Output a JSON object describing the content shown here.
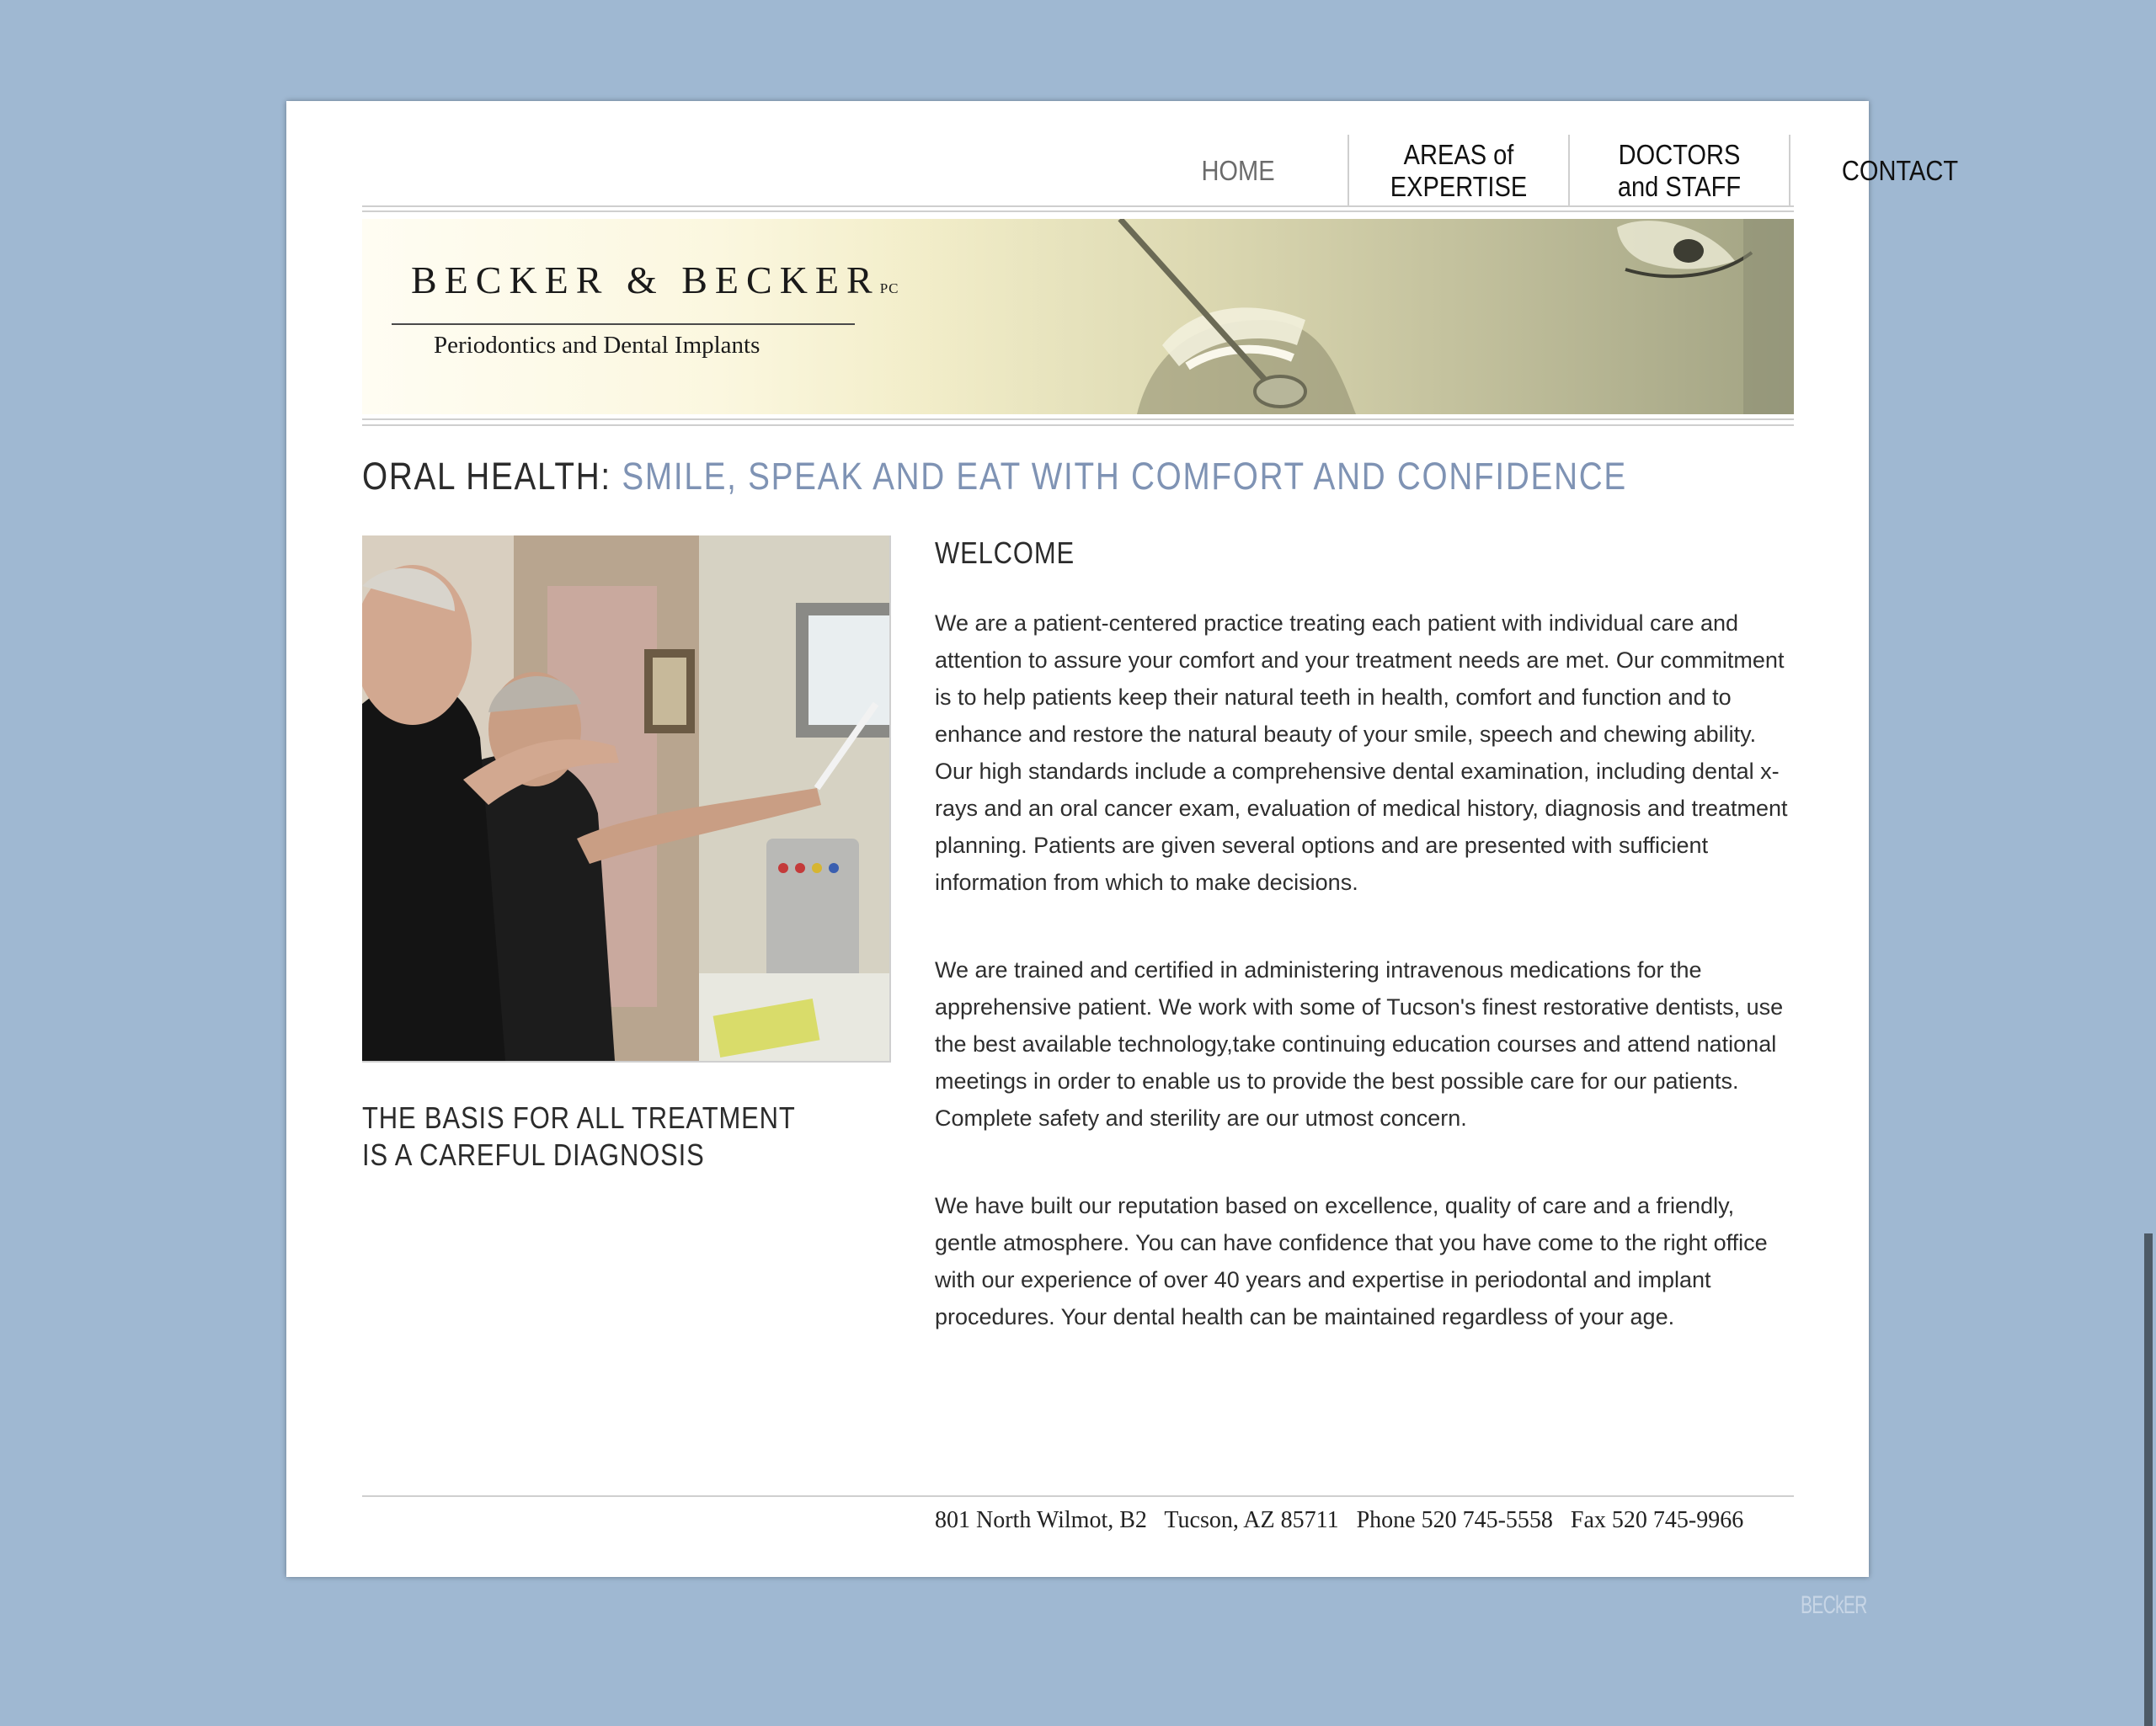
{
  "nav": {
    "items": [
      {
        "label": "HOME"
      },
      {
        "label": "AREAS of\nEXPERTISE"
      },
      {
        "label": "DOCTORS\nand STAFF"
      },
      {
        "label": "CONTACT"
      }
    ]
  },
  "banner": {
    "brand_name": "BECKER & BECKER",
    "brand_suffix": "PC",
    "tagline": "Periodontics and Dental Implants"
  },
  "headline": {
    "label": "ORAL HEALTH:",
    "accent": "SMILE, SPEAK AND EAT WITH COMFORT AND CONFIDENCE"
  },
  "sidebar": {
    "caption": "THE BASIS FOR ALL TREATMENT\nIS A CAREFUL DIAGNOSIS"
  },
  "main": {
    "heading": "WELCOME",
    "paragraphs": [
      "We are a patient-centered practice treating each patient with individual care and attention to assure your comfort and your treatment needs are met. Our commitment is to help patients keep their natural teeth in health, comfort and function and to enhance and restore the natural beauty of your smile, speech and chewing ability. Our high standards include a comprehensive dental examination, including dental x-rays and an oral cancer exam, evaluation of medical history, diagnosis and treatment planning. Patients are given several options and are presented with sufficient information from which to make decisions.",
      "We are trained and certified in administering intravenous medications for the apprehensive patient. We work with some of Tucson's finest restorative dentists, use the best available technology,take continuing education courses and attend national meetings in order to enable us to provide the best possible care for our patients. Complete safety and sterility are our utmost concern.",
      "We have built our reputation based on excellence, quality of care and a friendly, gentle atmosphere. You can have confidence that you have come to the right office with our experience of over 40 years and expertise in periodontal and implant procedures. Your dental health can be maintained regardless of your age."
    ]
  },
  "footer": {
    "address": "801 North Wilmot, B2   Tucson, AZ 85711   Phone 520 745-5558   Fax 520 745-9966"
  },
  "watermark": "BECkER",
  "colors": {
    "background": "#9fb8d2",
    "accent": "#7f93b4",
    "page": "#ffffff"
  }
}
